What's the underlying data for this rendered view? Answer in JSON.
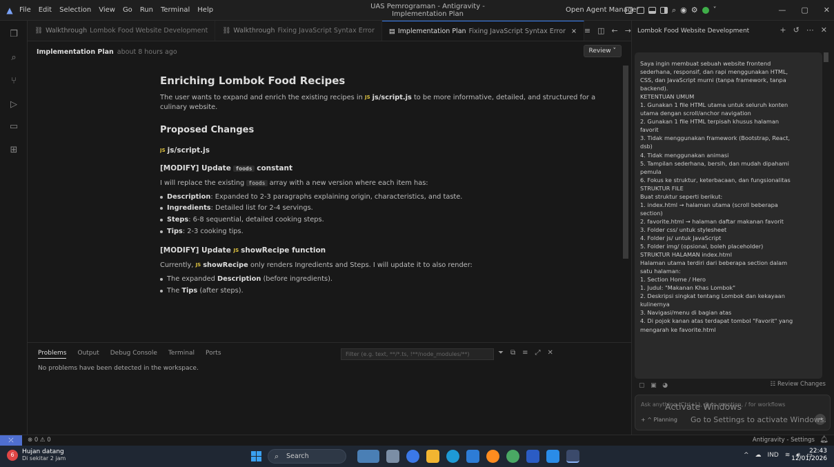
{
  "titlebar": {
    "menu": [
      "File",
      "Edit",
      "Selection",
      "View",
      "Go",
      "Run",
      "Terminal",
      "Help"
    ],
    "window_title": "UAS Pemrograman - Antigravity - Implementation Plan",
    "open_agent_manager": "Open Agent Manager"
  },
  "tabs": [
    {
      "label": "Walkthrough",
      "sub": "Lombok Food Website Development"
    },
    {
      "label": "Walkthrough",
      "sub": "Fixing JavaScript Syntax Error"
    },
    {
      "label": "Implementation Plan",
      "sub": "Fixing JavaScript Syntax Error",
      "close": "×"
    }
  ],
  "plan_header": {
    "title": "Implementation Plan",
    "time": "about 8 hours ago",
    "review": "Review ˅"
  },
  "doc": {
    "h1": "Enriching Lombok Food Recipes",
    "intro_pre": "The user wants to expand and enrich the existing recipes in",
    "intro_file": "js/script.js",
    "intro_post": "to be more informative, detailed, and structured for a culinary website.",
    "h2": "Proposed Changes",
    "file_heading": "js/script.js",
    "js_badge": "JS",
    "mod1_pre": "[MODIFY] Update",
    "mod1_code": "foods",
    "mod1_post": "constant",
    "mod1_p_pre": "I will replace the existing",
    "mod1_p_code": "foods",
    "mod1_p_post": "array with a new version where each item has:",
    "bullets": [
      {
        "bold": "Description",
        "text": ": Expanded to 2-3 paragraphs explaining origin, characteristics, and taste."
      },
      {
        "bold": "Ingredients",
        "text": ": Detailed list for 2-4 servings."
      },
      {
        "bold": "Steps",
        "text": ": 6-8 sequential, detailed cooking steps."
      },
      {
        "bold": "Tips",
        "text": ": 2-3 cooking tips."
      }
    ],
    "mod2_pre": "[MODIFY] Update",
    "mod2_fn": "showRecipe",
    "mod2_post": "function",
    "mod2_p_pre": "Currently,",
    "mod2_p_fn": "showRecipe",
    "mod2_p_post": "only renders Ingredients and Steps. I will update it to also render:",
    "bullets2": [
      {
        "pre": "The expanded ",
        "bold": "Description",
        "post": " (before ingredients)."
      },
      {
        "pre": "The ",
        "bold": "Tips",
        "post": " (after steps)."
      }
    ]
  },
  "panel": {
    "tabs": [
      "Problems",
      "Output",
      "Debug Console",
      "Terminal",
      "Ports"
    ],
    "filter_placeholder": "Filter (e.g. text, **/*.ts, !**/node_modules/**)",
    "message": "No problems have been detected in the workspace."
  },
  "right": {
    "title": "Lombok Food Website Development",
    "message_lines": [
      "Saya ingin membuat sebuah website frontend",
      "sederhana, responsif, dan rapi menggunakan HTML,",
      "CSS, dan JavaScript murni (tanpa framework, tanpa",
      "backend).",
      "KETENTUAN UMUM",
      "1. Gunakan 1 file HTML utama untuk seluruh konten",
      "utama dengan scroll/anchor navigation",
      "2. Gunakan 1 file HTML terpisah khusus halaman",
      "favorit",
      "3. Tidak menggunakan framework (Bootstrap, React,",
      "dsb)",
      "4. Tidak menggunakan animasi",
      "5. Tampilan sederhana, bersih, dan mudah dipahami",
      "pemula",
      "6. Fokus ke struktur, keterbacaan, dan fungsionalitas",
      "STRUKTUR FILE",
      "Buat struktur seperti berikut:",
      "1. index.html → halaman utama (scroll beberapa",
      "section)",
      "2. favorite.html → halaman daftar makanan favorit",
      "3. Folder css/ untuk stylesheet",
      "4. Folder js/ untuk JavaScript",
      "5. Folder img/ (opsional, boleh placeholder)",
      "STRUKTUR HALAMAN index.html",
      "Halaman utama terdiri dari beberapa section dalam",
      "satu halaman:",
      "1. Section Home / Hero",
      "1. Judul: \"Makanan Khas Lombok\"",
      "2. Deskripsi singkat tentang Lombok dan kekayaan",
      "kulinernya",
      "3. Navigasi/menu di bagian atas",
      "4. Di pojok kanan atas terdapat tombol \"Favorit\" yang",
      "mengarah ke favorite.html"
    ],
    "review_changes": "Review Changes",
    "ask_placeholder": "Ask anything (Ctrl+L), @ to mention, / for workflows",
    "planning": "+   ^ Planning",
    "watermark_title": "Activate Windows",
    "watermark_sub": "Go to Settings to activate Windows."
  },
  "status": {
    "errors": "⊗ 0 ⚠ 0",
    "right": "Antigravity - Settings"
  },
  "taskbar": {
    "weather_badge": "6",
    "weather_title": "Hujan datang",
    "weather_sub": "Di sekitar 2 jam",
    "search": "Search",
    "lang": "IND",
    "time": "22:43",
    "date": "12/01/2026"
  }
}
